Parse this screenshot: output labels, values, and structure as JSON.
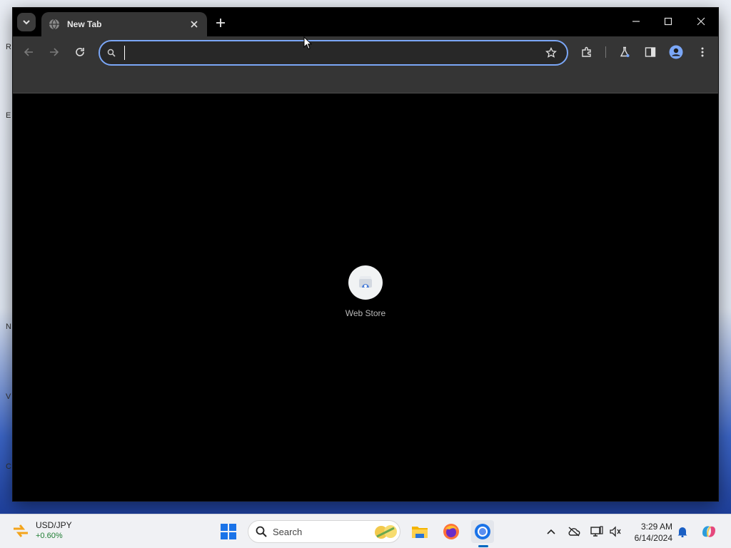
{
  "browser": {
    "tab": {
      "title": "New Tab"
    },
    "omnibox": {
      "value": "",
      "placeholder": ""
    },
    "shortcut": {
      "label": "Web Store"
    }
  },
  "taskbar": {
    "widget": {
      "pair": "USD/JPY",
      "change": "+0.60%"
    },
    "search": {
      "placeholder": "Search"
    },
    "clock": {
      "time": "3:29 AM",
      "date": "6/14/2024"
    }
  },
  "colors": {
    "omnibox_focus": "#7ba7f7",
    "toolbar": "#353535",
    "content_bg": "#000000",
    "positive_change": "#1e7d32",
    "accent": "#0067c0"
  },
  "icons": [
    "tab-search-icon",
    "globe-icon",
    "close-icon",
    "plus-icon",
    "minimize-icon",
    "maximize-icon",
    "back-icon",
    "forward-icon",
    "reload-icon",
    "search-icon",
    "star-icon",
    "extensions-icon",
    "labs-icon",
    "side-panel-icon",
    "profile-icon",
    "kebab-menu-icon",
    "web-store-icon",
    "windows-start-icon",
    "file-explorer-icon",
    "firefox-icon",
    "chrome-icon",
    "chevron-up-icon",
    "cloud-off-icon",
    "network-icon",
    "volume-icon",
    "bell-icon",
    "copilot-icon"
  ]
}
